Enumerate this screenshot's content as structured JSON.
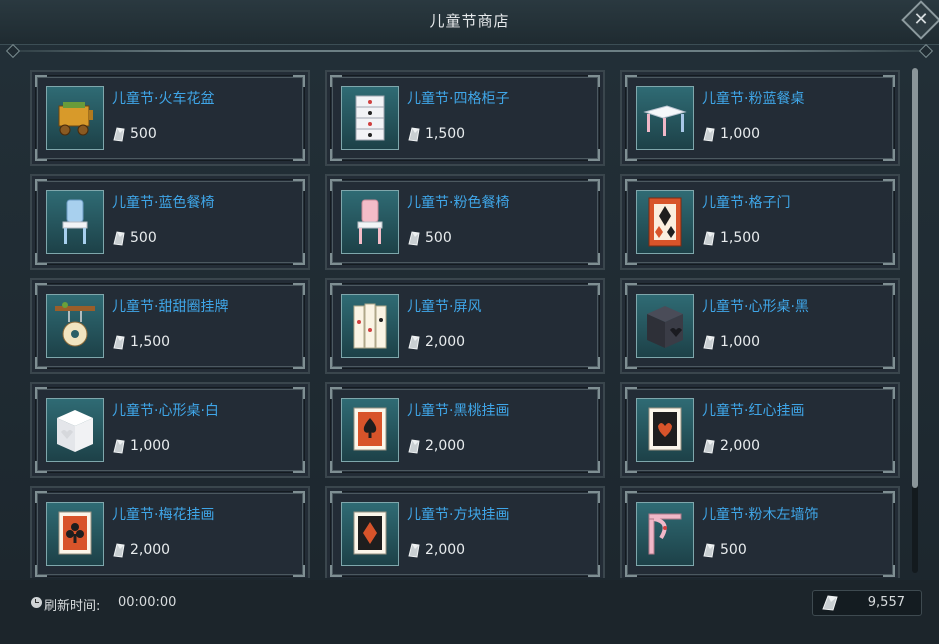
{
  "window": {
    "title": "儿童节商店",
    "close_label": "✕"
  },
  "items": [
    {
      "name": "儿童节·火车花盆",
      "price": "500",
      "icon": "train-planter-icon"
    },
    {
      "name": "儿童节·四格柜子",
      "price": "1,500",
      "icon": "four-grid-cabinet-icon"
    },
    {
      "name": "儿童节·粉蓝餐桌",
      "price": "1,000",
      "icon": "pink-blue-table-icon"
    },
    {
      "name": "儿童节·蓝色餐椅",
      "price": "500",
      "icon": "blue-chair-icon"
    },
    {
      "name": "儿童节·粉色餐椅",
      "price": "500",
      "icon": "pink-chair-icon"
    },
    {
      "name": "儿童节·格子门",
      "price": "1,500",
      "icon": "lattice-door-icon"
    },
    {
      "name": "儿童节·甜甜圈挂牌",
      "price": "1,500",
      "icon": "donut-sign-icon"
    },
    {
      "name": "儿童节·屏风",
      "price": "2,000",
      "icon": "folding-screen-icon"
    },
    {
      "name": "儿童节·心形桌·黑",
      "price": "1,000",
      "icon": "heart-table-black-icon"
    },
    {
      "name": "儿童节·心形桌·白",
      "price": "1,000",
      "icon": "heart-table-white-icon"
    },
    {
      "name": "儿童节·黑桃挂画",
      "price": "2,000",
      "icon": "spade-painting-icon"
    },
    {
      "name": "儿童节·红心挂画",
      "price": "2,000",
      "icon": "heart-painting-icon"
    },
    {
      "name": "儿童节·梅花挂画",
      "price": "2,000",
      "icon": "club-painting-icon"
    },
    {
      "name": "儿童节·方块挂画",
      "price": "2,000",
      "icon": "diamond-painting-icon"
    },
    {
      "name": "儿童节·粉木左墙饰",
      "price": "500",
      "icon": "pink-wood-wall-bracket-icon"
    }
  ],
  "footer": {
    "refresh_label": "刷新时间:",
    "refresh_time": "00:00:00",
    "currency_balance": "9,557",
    "currency_icon": "silver-crystal-icon"
  },
  "colors": {
    "item_name": "#3fa6e8",
    "frame": "#2f6b74",
    "background": "#1f2a31"
  }
}
